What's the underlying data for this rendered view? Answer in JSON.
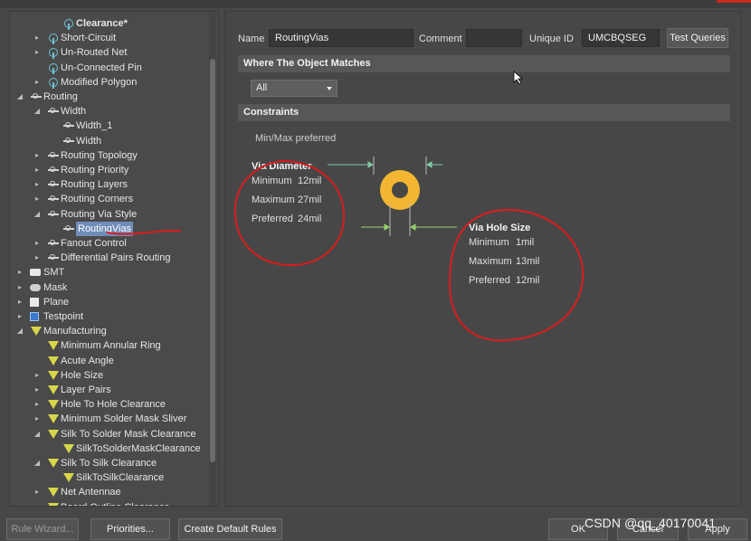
{
  "tree": {
    "items": [
      {
        "label": "Clearance*",
        "level": 3,
        "icon": "rule-icon",
        "arrow": "",
        "bold": true
      },
      {
        "label": "Short-Circuit",
        "level": 2,
        "icon": "rule-icon",
        "arrow": "▸"
      },
      {
        "label": "Un-Routed Net",
        "level": 2,
        "icon": "rule-icon",
        "arrow": "▸"
      },
      {
        "label": "Un-Connected Pin",
        "level": 2,
        "icon": "rule-icon",
        "arrow": ""
      },
      {
        "label": "Modified Polygon",
        "level": 2,
        "icon": "rule-icon",
        "arrow": "▸"
      },
      {
        "label": "Routing",
        "level": 1,
        "icon": "route-icon",
        "arrow": "◢"
      },
      {
        "label": "Width",
        "level": 2,
        "icon": "route-icon",
        "arrow": "◢"
      },
      {
        "label": "Width_1",
        "level": 3,
        "icon": "route-icon",
        "arrow": ""
      },
      {
        "label": "Width",
        "level": 3,
        "icon": "route-icon",
        "arrow": ""
      },
      {
        "label": "Routing Topology",
        "level": 2,
        "icon": "route-icon",
        "arrow": "▸"
      },
      {
        "label": "Routing Priority",
        "level": 2,
        "icon": "route-icon",
        "arrow": "▸"
      },
      {
        "label": "Routing Layers",
        "level": 2,
        "icon": "route-icon",
        "arrow": "▸"
      },
      {
        "label": "Routing Corners",
        "level": 2,
        "icon": "route-icon",
        "arrow": "▸"
      },
      {
        "label": "Routing Via Style",
        "level": 2,
        "icon": "route-icon",
        "arrow": "◢"
      },
      {
        "label": "RoutingVias",
        "level": 3,
        "icon": "route-icon",
        "arrow": "",
        "selected": true
      },
      {
        "label": "Fanout Control",
        "level": 2,
        "icon": "route-icon",
        "arrow": "▸"
      },
      {
        "label": "Differential Pairs Routing",
        "level": 2,
        "icon": "route-icon",
        "arrow": "▸"
      },
      {
        "label": "SMT",
        "level": 1,
        "icon": "smt-icon",
        "arrow": "▸"
      },
      {
        "label": "Mask",
        "level": 1,
        "icon": "mask-icon",
        "arrow": "▸"
      },
      {
        "label": "Plane",
        "level": 1,
        "icon": "plane-icon",
        "arrow": "▸"
      },
      {
        "label": "Testpoint",
        "level": 1,
        "icon": "testpoint-icon",
        "arrow": "▸"
      },
      {
        "label": "Manufacturing",
        "level": 1,
        "icon": "manufacturing-icon",
        "arrow": "◢"
      },
      {
        "label": "Minimum Annular Ring",
        "level": 2,
        "icon": "manufacturing-icon",
        "arrow": ""
      },
      {
        "label": "Acute Angle",
        "level": 2,
        "icon": "manufacturing-icon",
        "arrow": ""
      },
      {
        "label": "Hole Size",
        "level": 2,
        "icon": "manufacturing-icon",
        "arrow": "▸"
      },
      {
        "label": "Layer Pairs",
        "level": 2,
        "icon": "manufacturing-icon",
        "arrow": "▸"
      },
      {
        "label": "Hole To Hole Clearance",
        "level": 2,
        "icon": "manufacturing-icon",
        "arrow": "▸"
      },
      {
        "label": "Minimum Solder Mask Sliver",
        "level": 2,
        "icon": "manufacturing-icon",
        "arrow": "▸"
      },
      {
        "label": "Silk To Solder Mask Clearance",
        "level": 2,
        "icon": "manufacturing-icon",
        "arrow": "◢"
      },
      {
        "label": "SilkToSolderMaskClearance",
        "level": 3,
        "icon": "manufacturing-icon",
        "arrow": ""
      },
      {
        "label": "Silk To Silk Clearance",
        "level": 2,
        "icon": "manufacturing-icon",
        "arrow": "◢"
      },
      {
        "label": "SilkToSilkClearance",
        "level": 3,
        "icon": "manufacturing-icon",
        "arrow": ""
      },
      {
        "label": "Net Antennae",
        "level": 2,
        "icon": "manufacturing-icon",
        "arrow": "▸"
      },
      {
        "label": "Board Outline Clearance",
        "level": 2,
        "icon": "manufacturing-icon",
        "arrow": "▸"
      }
    ]
  },
  "rule": {
    "name_label": "Name",
    "name_value": "RoutingVias",
    "comment_label": "Comment",
    "comment_value": "",
    "uid_label": "Unique ID",
    "uid_value": "UMCBQSEG",
    "test_queries": "Test Queries"
  },
  "where": {
    "header": "Where The Object Matches",
    "select_value": "All"
  },
  "constraints": {
    "header": "Constraints",
    "mode": "Min/Max preferred",
    "via_diameter": {
      "title": "Via Diameter",
      "min_label": "Minimum",
      "min_value": "12mil",
      "max_label": "Maximum",
      "max_value": "27mil",
      "pref_label": "Preferred",
      "pref_value": "24mil"
    },
    "via_hole": {
      "title": "Via Hole Size",
      "min_label": "Minimum",
      "min_value": "1mil",
      "max_label": "Maximum",
      "max_value": "13mil",
      "pref_label": "Preferred",
      "pref_value": "12mil"
    },
    "via_color": "#f2b632"
  },
  "bottom": {
    "rule_wizard": "Rule Wizard...",
    "priorities": "Priorities...",
    "create_default": "Create Default Rules",
    "ok": "OK",
    "cancel": "Cancel",
    "apply": "Apply"
  },
  "watermark": "CSDN @qq_40170041"
}
